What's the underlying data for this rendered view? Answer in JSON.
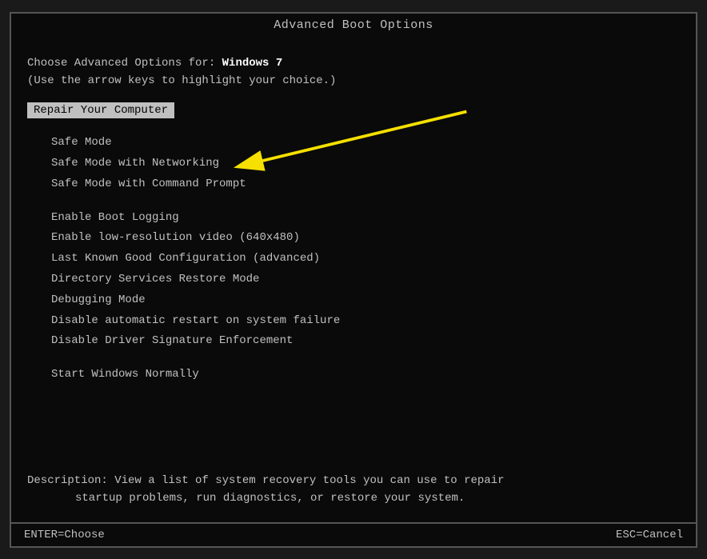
{
  "title": "Advanced Boot Options",
  "intro": {
    "line1_prefix": "Choose Advanced Options for: ",
    "line1_os": "Windows 7",
    "line2": "(Use the arrow keys to highlight your choice.)"
  },
  "selected_item": "Repair Your Computer",
  "menu_groups": [
    {
      "items": [
        "Safe Mode",
        "Safe Mode with Networking",
        "Safe Mode with Command Prompt"
      ]
    },
    {
      "items": [
        "Enable Boot Logging",
        "Enable low-resolution video (640x480)",
        "Last Known Good Configuration (advanced)",
        "Directory Services Restore Mode",
        "Debugging Mode",
        "Disable automatic restart on system failure",
        "Disable Driver Signature Enforcement"
      ]
    },
    {
      "items": [
        "Start Windows Normally"
      ]
    }
  ],
  "description": {
    "prefix": "Description: ",
    "text": "View a list of system recovery tools you can use to repair",
    "text2": "startup problems, run diagnostics, or restore your system."
  },
  "footer": {
    "enter_label": "ENTER=Choose",
    "esc_label": "ESC=Cancel"
  },
  "arrow": {
    "color": "#f5e000"
  }
}
